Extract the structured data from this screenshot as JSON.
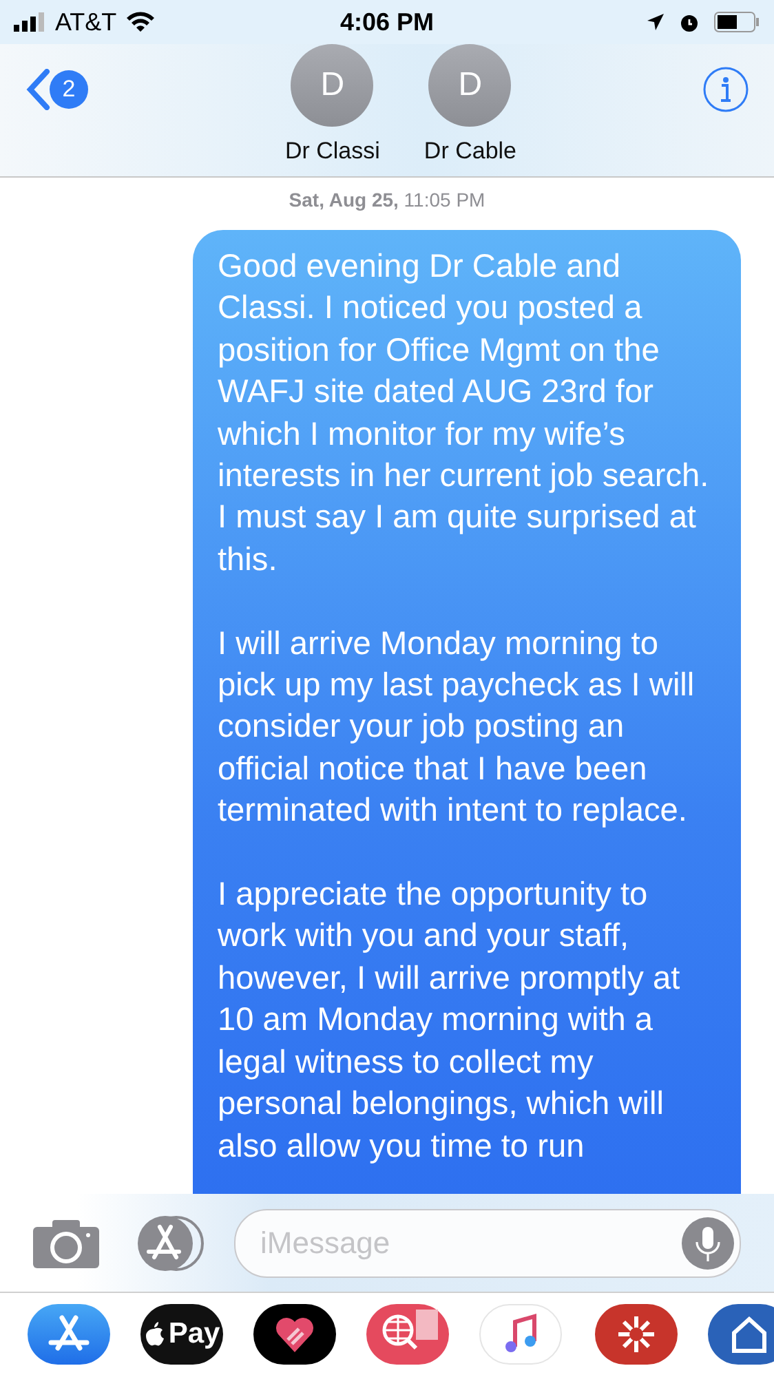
{
  "status_bar": {
    "carrier": "AT&T",
    "time": "4:06 PM"
  },
  "header": {
    "back_badge": "2",
    "contacts": [
      {
        "initial": "D",
        "name": "Dr Classi"
      },
      {
        "initial": "D",
        "name": "Dr Cable"
      }
    ]
  },
  "timestamp": "**Sat, Aug 25,** 11:05 PM",
  "message": {
    "paragraphs": [
      "Good evening Dr Cable and Classi. I noticed you posted a position for Office Mgmt on the WAFJ site dated AUG 23rd for which I monitor for my wife’s interests in her current job search. I must say I am quite surprised at this.",
      "I will arrive Monday morning to pick up my last paycheck as I will consider your job posting an official notice that I have been terminated with intent to replace.",
      "I appreciate the opportunity to work with you and your staff, however, I will arrive promptly at 10 am Monday morning with a legal witness to collect my personal belongings, which will also allow you time to run"
    ]
  },
  "input": {
    "placeholder": "iMessage"
  },
  "apps": [
    {
      "kind": "store"
    },
    {
      "kind": "pay",
      "label": "Pay"
    },
    {
      "kind": "heart"
    },
    {
      "kind": "globe"
    },
    {
      "kind": "music"
    },
    {
      "kind": "badge"
    },
    {
      "kind": "letters"
    }
  ]
}
